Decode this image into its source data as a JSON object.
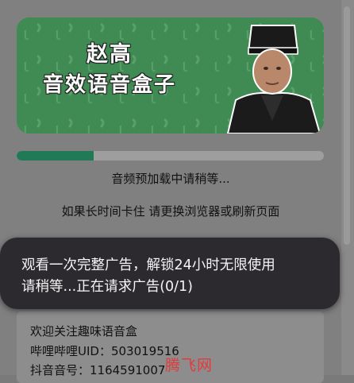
{
  "banner": {
    "title_line1": "赵高",
    "title_line2": "音效语音盒子",
    "portrait_icon": "portrait-zhao-gao-icon"
  },
  "loading": {
    "progress_fraction": 0.25,
    "status_text": "音频预加载中请稍等...",
    "hint_text": "如果长时间卡住 请更换浏览器或刷新页面",
    "hidden_text": "…"
  },
  "toast": {
    "line1": "观看一次完整广告，解锁24小时无限使用",
    "line2": "请稍等...正在请求广告(0/1)"
  },
  "info": {
    "welcome": "欢迎关注趣味语音盒",
    "bilibili_uid": "哔哩哔哩UID：503019516",
    "douyin_id": "抖音音号：1164591007"
  },
  "watermark": "腾飞网",
  "colors": {
    "accent_green": "#1f7a55",
    "banner_green": "#3e8a52",
    "toast_bg": "#2c2a2f",
    "watermark_red": "#e23b3b"
  }
}
